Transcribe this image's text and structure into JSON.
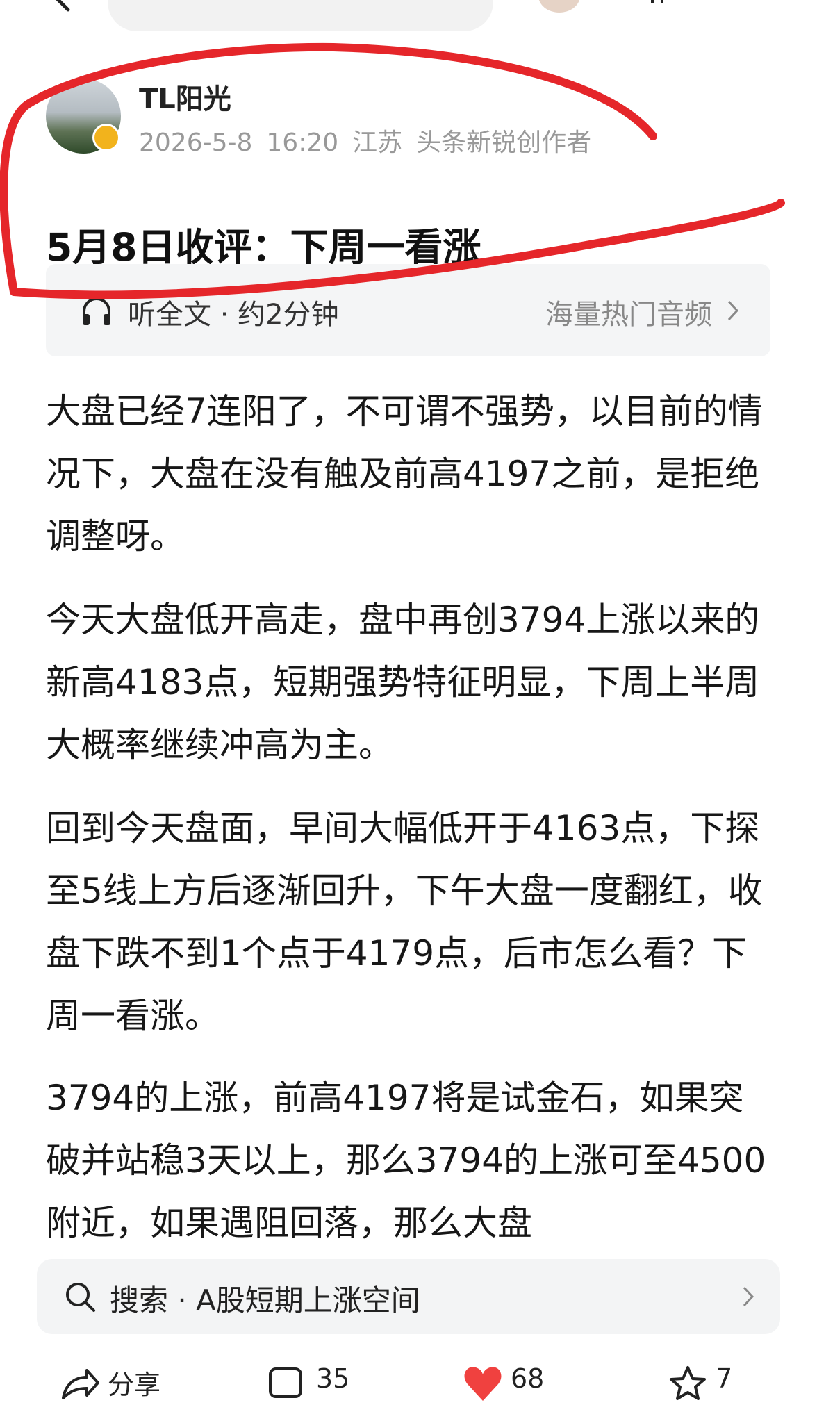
{
  "topbar": {
    "search_placeholder": "",
    "icons": [
      "back-arrow-icon",
      "avatar",
      "more-icon"
    ]
  },
  "author": {
    "name": "TL阳光",
    "date": "2026-5-8",
    "time": "16:20",
    "location": "江苏",
    "tag": "头条新锐创作者"
  },
  "article": {
    "title": "5月8日收评：下周一看涨",
    "paragraphs": [
      "大盘已经7连阳了，不可谓不强势，以目前的情况下，大盘在没有触及前高4197之前，是拒绝调整呀。",
      "今天大盘低开高走，盘中再创3794上涨以来的新高4183点，短期强势特征明显，下周上半周大概率继续冲高为主。",
      "回到今天盘面，早间大幅低开于4163点，下探至5线上方后逐渐回升，下午大盘一度翻红，收盘下跌不到1个点于4179点，后市怎么看？下周一看涨。",
      "3794的上涨，前高4197将是试金石，如果突破并站稳3天以上，那么3794的上涨可至4500附近，如果遇阻回落，那么大盘"
    ]
  },
  "audio": {
    "label": "听全文 · 约2分钟",
    "right_label": "海量热门音频"
  },
  "related_search": {
    "text": "搜索 · A股短期上涨空间"
  },
  "actions": {
    "share_label": "分享",
    "comment_count": "35",
    "like_count": "68",
    "favorite_count": "7"
  },
  "colors": {
    "annotation_red": "#e5262a",
    "like_red": "#f0413f",
    "badge_gold": "#f2b31c"
  }
}
